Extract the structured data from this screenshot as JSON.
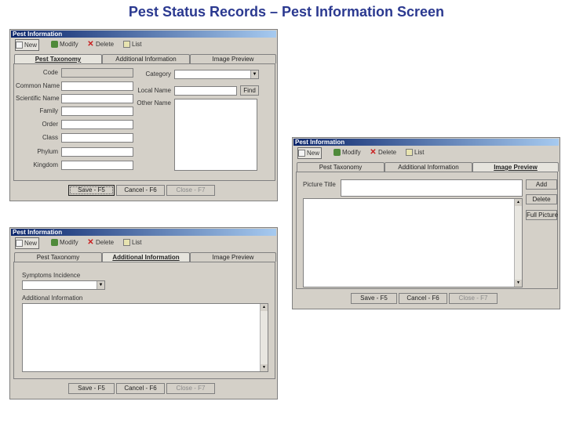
{
  "page_title": "Pest Status Records – Pest Information Screen",
  "window_title": "Pest Information",
  "toolbar": {
    "new": "New",
    "modify": "Modify",
    "delete": "Delete",
    "list": "List"
  },
  "tabs": {
    "taxonomy": "Pest Taxonomy",
    "taxonomy_short": "Pest Taxonomy",
    "additional": "Additional Information",
    "image": "Image Preview"
  },
  "taxonomy": {
    "code": "Code",
    "common_name": "Common Name",
    "scientific_name": "Scientific Name",
    "family": "Family",
    "order": "Order",
    "class": "Class",
    "phylum": "Phylum",
    "kingdom": "Kingdom",
    "category": "Category",
    "local_name": "Local Name",
    "other_name": "Other Name",
    "find": "Find"
  },
  "additional": {
    "symptoms": "Symptoms Incidence",
    "info": "Additional Information"
  },
  "image": {
    "picture_title": "Picture Title",
    "add": "Add",
    "delete": "Delete",
    "full_picture": "Full Picture"
  },
  "footer": {
    "save": "Save - F5",
    "cancel": "Cancel - F6",
    "close": "Close - F7"
  }
}
